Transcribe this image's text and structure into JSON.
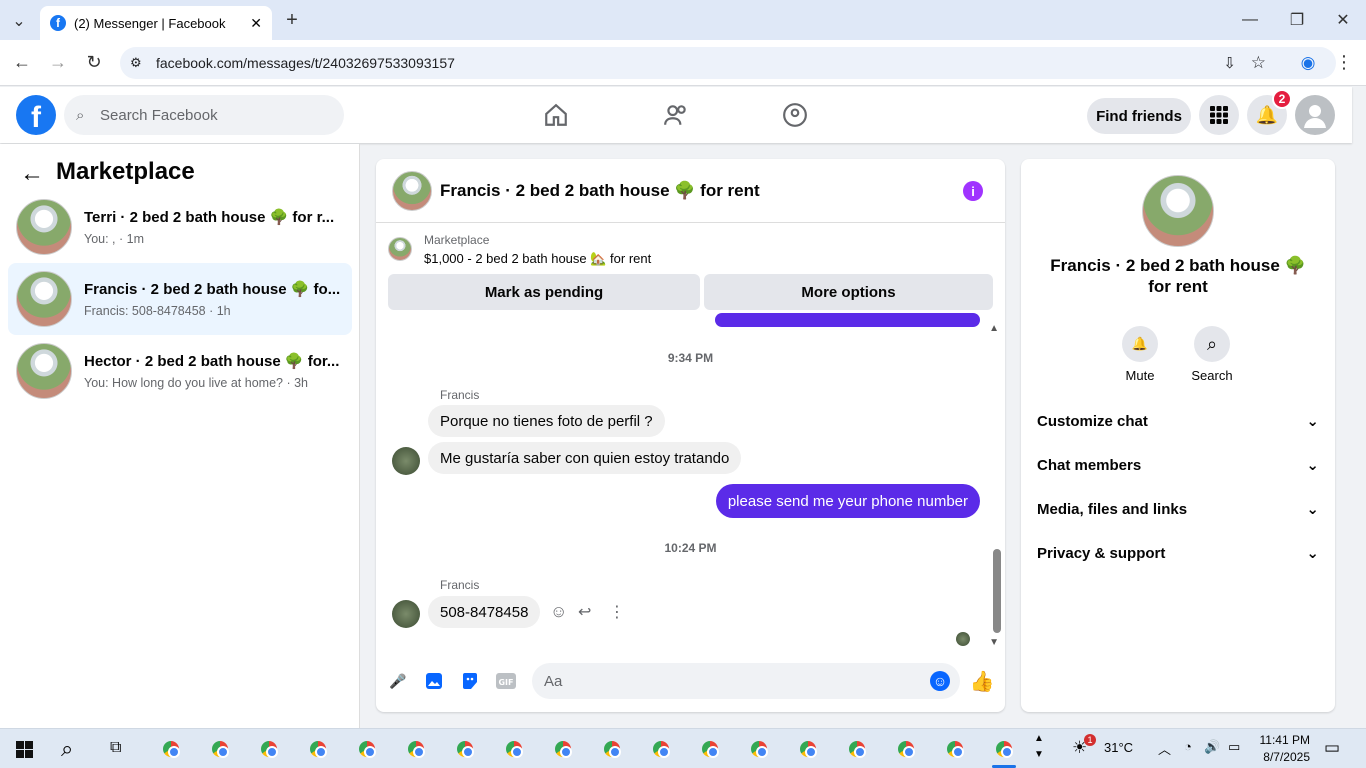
{
  "browser": {
    "tab_title": "(2) Messenger | Facebook",
    "url": "facebook.com/messages/t/24032697533093157"
  },
  "fb_nav": {
    "search_placeholder": "Search Facebook",
    "find_friends": "Find friends",
    "notif_count": "2"
  },
  "left_panel": {
    "title": "Marketplace",
    "conversations": [
      {
        "name": "Terri · 2 bed 2 bath house 🌳 for r...",
        "sub": "You: , · 1m"
      },
      {
        "name": "Francis · 2 bed 2 bath house 🌳 fo...",
        "sub": "Francis: 508-8478458 · 1h"
      },
      {
        "name": "Hector · 2 bed 2 bath house 🌳 for...",
        "sub": "You: How long do you live at home? · 3h"
      }
    ]
  },
  "chat": {
    "title": "Francis · 2 bed 2 bath house 🌳 for rent",
    "marketplace_label": "Marketplace",
    "listing": "$1,000 - 2 bed 2 bath house 🏡 for rent",
    "mark_pending": "Mark as pending",
    "more_options": "More options",
    "time1": "9:34 PM",
    "sender1": "Francis",
    "msg1": "Porque no tienes foto de perfil ?",
    "msg2": "Me gustaría saber con quien estoy tratando",
    "my_msg": "please send me yeur  phone number",
    "time2": "10:24 PM",
    "sender2": "Francis",
    "msg3": "508-8478458",
    "composer_placeholder": "Aa"
  },
  "right_panel": {
    "name": "Francis · 2 bed 2 bath house 🌳 for rent",
    "mute": "Mute",
    "search": "Search",
    "sections": [
      "Customize chat",
      "Chat members",
      "Media, files and links",
      "Privacy & support"
    ]
  },
  "taskbar": {
    "temp": "31°C",
    "time": "11:41 PM",
    "date": "8/7/2025",
    "weather_badge": "1"
  },
  "colors": {
    "brand": "#1877f2",
    "my_bubble": "#5b2be8",
    "info": "#a033ff"
  }
}
